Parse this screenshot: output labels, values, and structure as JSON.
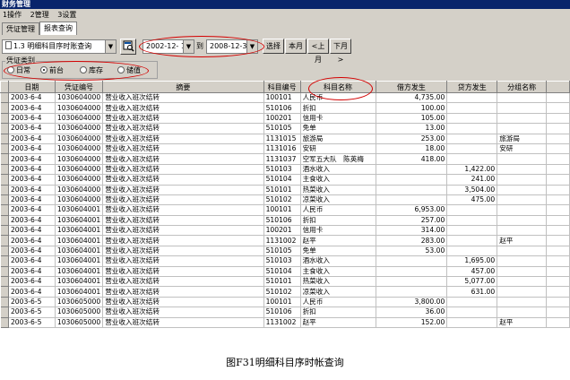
{
  "window": {
    "title": "财务管理"
  },
  "menu": [
    "1操作",
    "2管理",
    "3设置"
  ],
  "tabs": [
    "凭证管理",
    "报表查询"
  ],
  "toolbar": {
    "report_select": "1.3 明细科目序时账查询",
    "date_from": "2002-12- 1",
    "date_sep": "到",
    "date_to": "2008-12-31",
    "select_label": "选择",
    "month_label": "本月",
    "prev_month_label": "<上月",
    "next_month_label": "下月>"
  },
  "voucher_type": {
    "title": "凭证类别",
    "options": [
      "日常",
      "前台",
      "库存",
      "储值"
    ],
    "selected": "前台"
  },
  "table": {
    "columns": [
      "日期",
      "凭证编号",
      "摘要",
      "科目编号",
      "科目名称",
      "借方发生",
      "贷方发生",
      "分组名称"
    ],
    "rows": [
      [
        "2003-6-4",
        "1030604000",
        "营业收入班次结转",
        "100101",
        "人民币",
        "4,735.00",
        "",
        ""
      ],
      [
        "2003-6-4",
        "1030604000",
        "营业收入班次结转",
        "510106",
        "折扣",
        "100.00",
        "",
        ""
      ],
      [
        "2003-6-4",
        "1030604000",
        "营业收入班次结转",
        "100201",
        "信用卡",
        "105.00",
        "",
        ""
      ],
      [
        "2003-6-4",
        "1030604000",
        "营业收入班次结转",
        "510105",
        "免单",
        "13.00",
        "",
        ""
      ],
      [
        "2003-6-4",
        "1030604000",
        "营业收入班次结转",
        "1131015",
        "旅游局",
        "253.00",
        "",
        "旅游局"
      ],
      [
        "2003-6-4",
        "1030604000",
        "营业收入班次结转",
        "1131016",
        "安研",
        "18.00",
        "",
        "安研"
      ],
      [
        "2003-6-4",
        "1030604000",
        "营业收入班次结转",
        "1131037",
        "空军五大队　陈英梅",
        "418.00",
        "",
        ""
      ],
      [
        "2003-6-4",
        "1030604000",
        "营业收入班次结转",
        "510103",
        "酒水收入",
        "",
        "1,422.00",
        ""
      ],
      [
        "2003-6-4",
        "1030604000",
        "营业收入班次结转",
        "510104",
        "主食收入",
        "",
        "241.00",
        ""
      ],
      [
        "2003-6-4",
        "1030604000",
        "营业收入班次结转",
        "510101",
        "热菜收入",
        "",
        "3,504.00",
        ""
      ],
      [
        "2003-6-4",
        "1030604000",
        "营业收入班次结转",
        "510102",
        "凉菜收入",
        "",
        "475.00",
        ""
      ],
      [
        "2003-6-4",
        "1030604001",
        "营业收入班次结转",
        "100101",
        "人民币",
        "6,953.00",
        "",
        ""
      ],
      [
        "2003-6-4",
        "1030604001",
        "营业收入班次结转",
        "510106",
        "折扣",
        "257.00",
        "",
        ""
      ],
      [
        "2003-6-4",
        "1030604001",
        "营业收入班次结转",
        "100201",
        "信用卡",
        "314.00",
        "",
        ""
      ],
      [
        "2003-6-4",
        "1030604001",
        "营业收入班次结转",
        "1131002",
        "赵平",
        "283.00",
        "",
        "赵平"
      ],
      [
        "2003-6-4",
        "1030604001",
        "营业收入班次结转",
        "510105",
        "免单",
        "53.00",
        "",
        ""
      ],
      [
        "2003-6-4",
        "1030604001",
        "营业收入班次结转",
        "510103",
        "酒水收入",
        "",
        "1,695.00",
        ""
      ],
      [
        "2003-6-4",
        "1030604001",
        "营业收入班次结转",
        "510104",
        "主食收入",
        "",
        "457.00",
        ""
      ],
      [
        "2003-6-4",
        "1030604001",
        "营业收入班次结转",
        "510101",
        "热菜收入",
        "",
        "5,077.00",
        ""
      ],
      [
        "2003-6-4",
        "1030604001",
        "营业收入班次结转",
        "510102",
        "凉菜收入",
        "",
        "631.00",
        ""
      ],
      [
        "2003-6-5",
        "1030605000",
        "营业收入班次结转",
        "100101",
        "人民币",
        "3,800.00",
        "",
        ""
      ],
      [
        "2003-6-5",
        "1030605000",
        "营业收入班次结转",
        "510106",
        "折扣",
        "36.00",
        "",
        ""
      ],
      [
        "2003-6-5",
        "1030605000",
        "营业收入班次结转",
        "1131002",
        "赵平",
        "152.00",
        "",
        "赵平"
      ]
    ]
  },
  "caption": "图F31明细科目序时帐查询"
}
